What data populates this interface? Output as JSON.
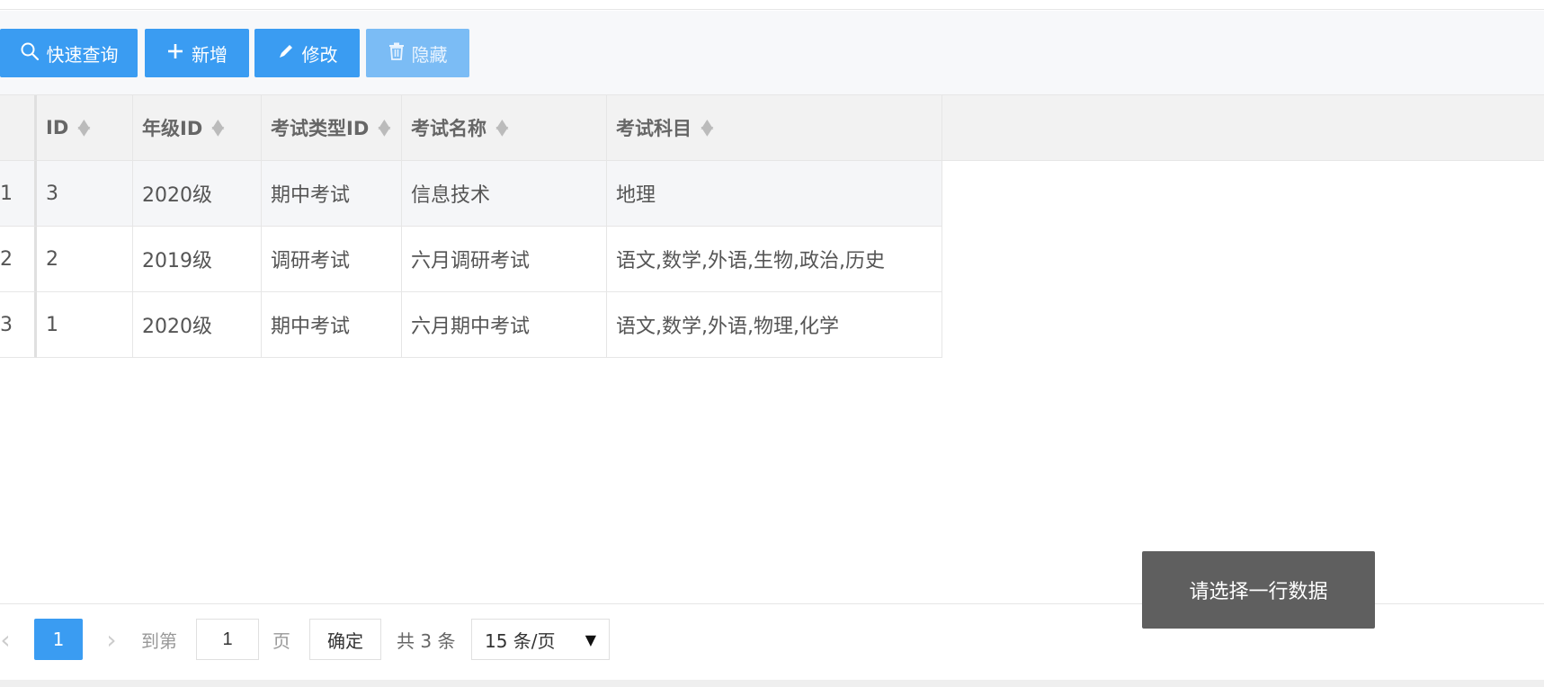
{
  "toolbar": {
    "quick_search_label": "快速查询",
    "add_label": "新增",
    "edit_label": "修改",
    "hide_label": "隐藏"
  },
  "table": {
    "columns": [
      "ID",
      "年级ID",
      "考试类型ID",
      "考试名称",
      "考试科目"
    ],
    "rows": [
      {
        "row_num": "1",
        "id": "3",
        "grade": "2020级",
        "type": "期中考试",
        "name": "信息技术",
        "subjects": "地理"
      },
      {
        "row_num": "2",
        "id": "2",
        "grade": "2019级",
        "type": "调研考试",
        "name": "六月调研考试",
        "subjects": "语文,数学,外语,生物,政治,历史"
      },
      {
        "row_num": "3",
        "id": "1",
        "grade": "2020级",
        "type": "期中考试",
        "name": "六月期中考试",
        "subjects": "语文,数学,外语,物理,化学"
      }
    ]
  },
  "pager": {
    "current_page": "1",
    "goto_label": "到第",
    "goto_value": "1",
    "page_label": "页",
    "confirm_label": "确定",
    "total_label": "共 3 条",
    "page_size": "15 条/页"
  },
  "toast": {
    "message": "请选择一行数据"
  },
  "colors": {
    "primary": "#3a9cf2",
    "primary_disabled": "#7bbcf5",
    "toast_bg": "#5f5f5f",
    "header_bg": "#f2f2f2"
  }
}
